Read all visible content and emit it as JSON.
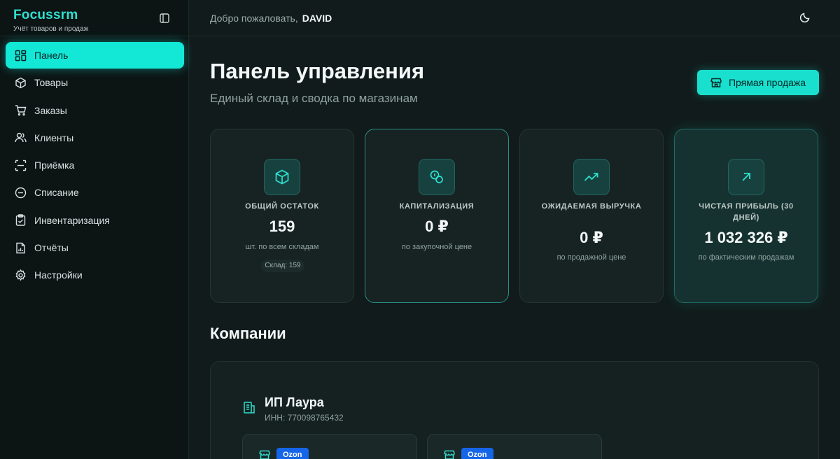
{
  "app": {
    "name": "Focussrm",
    "subtitle": "Учёт товаров и продаж"
  },
  "sidebar": {
    "items": [
      {
        "label": "Панель",
        "icon": "dashboard-icon",
        "active": true
      },
      {
        "label": "Товары",
        "icon": "box-icon"
      },
      {
        "label": "Заказы",
        "icon": "cart-icon"
      },
      {
        "label": "Клиенты",
        "icon": "users-icon"
      },
      {
        "label": "Приёмка",
        "icon": "scan-icon"
      },
      {
        "label": "Списание",
        "icon": "minus-circle-icon"
      },
      {
        "label": "Инвентаризация",
        "icon": "clipboard-check-icon"
      },
      {
        "label": "Отчёты",
        "icon": "report-icon"
      },
      {
        "label": "Настройки",
        "icon": "gear-icon"
      }
    ]
  },
  "header": {
    "welcome": "Добро пожаловать,",
    "user": "DAVID"
  },
  "main": {
    "title": "Панель управления",
    "subtitle": "Единый склад и сводка по магазинам",
    "direct_sale_label": "Прямая продажа"
  },
  "stats": [
    {
      "label": "ОБЩИЙ ОСТАТОК",
      "value": "159",
      "note": "шт. по всем складам",
      "chip": "Склад: 159",
      "icon": "box-icon"
    },
    {
      "label": "КАПИТАЛИЗАЦИЯ",
      "value": "0 ₽",
      "note": "по закупочной цене",
      "icon": "coins-icon"
    },
    {
      "label": "ОЖИДАЕМАЯ ВЫРУЧКА",
      "value": "0 ₽",
      "note": "по продажной цене",
      "icon": "trend-up-icon"
    },
    {
      "label": "ЧИСТАЯ ПРИБЫЛЬ (30 ДНЕЙ)",
      "value": "1 032 326 ₽",
      "note": "по фактическим продажам",
      "icon": "arrow-up-right-icon"
    }
  ],
  "companies": {
    "section_title": "Компании",
    "items": [
      {
        "name": "ИП Лаура",
        "inn": "ИНН: 770098765432",
        "stores": [
          {
            "marketplace": "Ozon"
          },
          {
            "marketplace": "Ozon"
          }
        ]
      }
    ]
  },
  "colors": {
    "accent": "#13e7d6",
    "background": "#111b1b",
    "sidebar": "#0c1414",
    "ozon": "#1565e8"
  }
}
